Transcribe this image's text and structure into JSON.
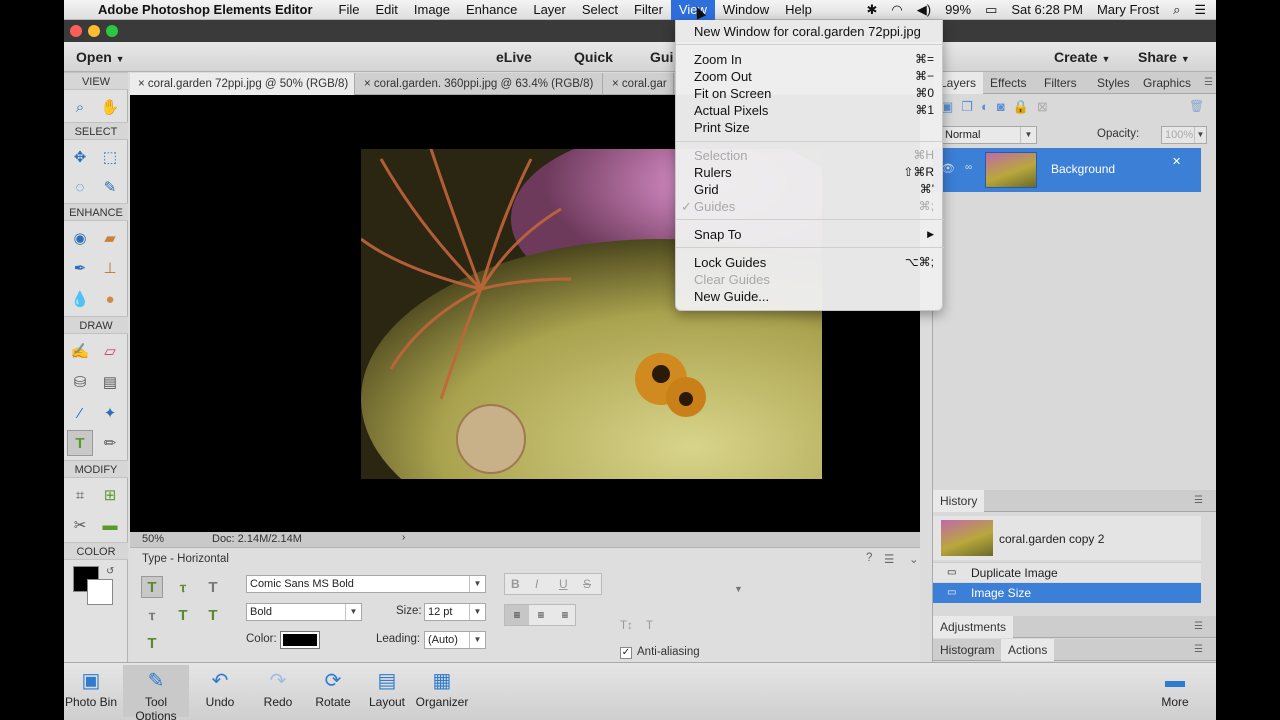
{
  "menubar": {
    "app": "Adobe Photoshop Elements Editor",
    "items": [
      "File",
      "Edit",
      "Image",
      "Enhance",
      "Layer",
      "Select",
      "Filter",
      "View",
      "Window",
      "Help"
    ],
    "battery": "99%",
    "clock": "Sat 6:28 PM",
    "user": "Mary Frost"
  },
  "topbar": {
    "open": "Open",
    "elive": "eLive",
    "quick": "Quick",
    "guided": "Gui",
    "create": "Create",
    "share": "Share"
  },
  "toolbox": {
    "sections": [
      "VIEW",
      "SELECT",
      "ENHANCE",
      "DRAW",
      "MODIFY",
      "COLOR"
    ]
  },
  "tabs": [
    "coral.garden 72ppi.jpg @ 50% (RGB/8)",
    "coral.garden. 360ppi.jpg @ 63.4% (RGB/8)",
    "coral.gar"
  ],
  "status": {
    "zoom": "50%",
    "doc": "Doc: 2.14M/2.14M"
  },
  "options": {
    "title": "Type - Horizontal",
    "font": "Comic Sans MS Bold",
    "style": "Bold",
    "size_label": "Size:",
    "size": "12 pt",
    "leading_label": "Leading:",
    "leading": "(Auto)",
    "color_label": "Color:",
    "antialias": "Anti-aliasing",
    "text_color": "#000000"
  },
  "layers": {
    "tabs": [
      "Layers",
      "Effects",
      "Filters",
      "Styles",
      "Graphics"
    ],
    "blend": "Normal",
    "opacity_label": "Opacity:",
    "opacity": "100%",
    "layer_name": "Background"
  },
  "history": {
    "title": "History",
    "items": [
      "coral.garden copy 2",
      "Duplicate Image",
      "Image Size"
    ]
  },
  "adjustments": {
    "title": "Adjustments"
  },
  "bottom_tabs": [
    "Histogram",
    "Actions"
  ],
  "bottombar": [
    "Photo Bin",
    "Tool Options",
    "Undo",
    "Redo",
    "Rotate",
    "Layout",
    "Organizer",
    "More"
  ],
  "viewmenu": {
    "new_window": "New Window for coral.garden 72ppi.jpg",
    "items": [
      {
        "label": "Zoom In",
        "shortcut": "⌘="
      },
      {
        "label": "Zoom Out",
        "shortcut": "⌘−"
      },
      {
        "label": "Fit on Screen",
        "shortcut": "⌘0"
      },
      {
        "label": "Actual Pixels",
        "shortcut": "⌘1"
      },
      {
        "label": "Print Size",
        "shortcut": ""
      },
      {
        "label": "Selection",
        "shortcut": "⌘H"
      },
      {
        "label": "Rulers",
        "shortcut": "⇧⌘R"
      },
      {
        "label": "Grid",
        "shortcut": "⌘'"
      },
      {
        "label": "Guides",
        "shortcut": "⌘;"
      },
      {
        "label": "Snap To",
        "shortcut": "▶"
      },
      {
        "label": "Lock Guides",
        "shortcut": "⌥⌘;"
      },
      {
        "label": "Clear Guides",
        "shortcut": ""
      },
      {
        "label": "New Guide...",
        "shortcut": ""
      }
    ]
  },
  "colors": {
    "accent": "#2f6fdc",
    "selected_row": "#3b7fd6"
  }
}
